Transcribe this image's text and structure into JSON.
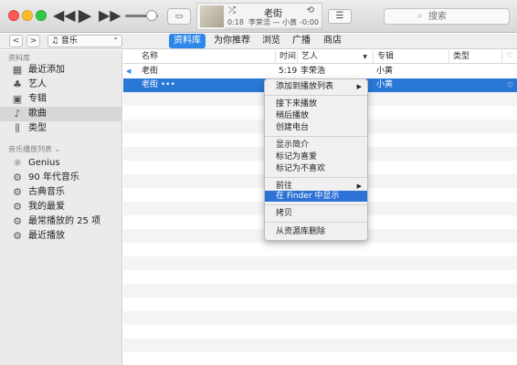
{
  "window": {
    "transport": {
      "prev": "◀◀",
      "play": "▶",
      "next": "▶▶"
    },
    "airplay": "▭",
    "now_playing": {
      "title": "老街",
      "shuffle_icon": "⤮",
      "repeat_icon": "⟲",
      "elapsed": "0:18",
      "artist_album": "李荣浩 — 小黄",
      "remaining": "-0:00",
      "progress": 0.05
    },
    "list_button": "☰",
    "search": {
      "placeholder": "搜索",
      "icon": "⌕"
    }
  },
  "toolbar": {
    "back": "<",
    "forward": ">",
    "media_selector": "♫ 音乐",
    "media_arrow": "⌃",
    "tabs": [
      {
        "label": "资料库",
        "active": true
      },
      {
        "label": "为你推荐"
      },
      {
        "label": "浏览"
      },
      {
        "label": "广播"
      },
      {
        "label": "商店"
      }
    ]
  },
  "sidebar": {
    "library_title": "资料库",
    "library_items": [
      {
        "label": "最近添加",
        "icon": "▦"
      },
      {
        "label": "艺人",
        "icon": "♣"
      },
      {
        "label": "专辑",
        "icon": "▣"
      },
      {
        "label": "歌曲",
        "icon": "♪",
        "selected": true
      },
      {
        "label": "类型",
        "icon": "⫼"
      }
    ],
    "playlists_title": "音乐播放列表 ⌄",
    "playlist_items": [
      {
        "label": "Genius",
        "icon": "⚛"
      },
      {
        "label": "90 年代音乐",
        "icon": "⚙"
      },
      {
        "label": "古典音乐",
        "icon": "⚙"
      },
      {
        "label": "我的最爱",
        "icon": "⚙"
      },
      {
        "label": "最常播放的 25 项",
        "icon": "⚙"
      },
      {
        "label": "最近播放",
        "icon": "⚙"
      }
    ]
  },
  "table": {
    "headers": {
      "name": "名称",
      "time": "时间",
      "artist": "艺人",
      "album": "专辑",
      "genre": "类型",
      "love": "♡"
    },
    "sort_arrow": "▼",
    "rows": [
      {
        "playing_icon": "◀",
        "name": "老街",
        "time": "5:19",
        "artist": "李荣浩",
        "album": "小黄"
      },
      {
        "name": "老街 •••",
        "album": "小黄",
        "love": "♡"
      }
    ]
  },
  "context_menu": {
    "items": [
      {
        "label": "添加到播放列表",
        "submenu": "▶"
      },
      {
        "label": "接下来播放"
      },
      {
        "label": "稍后播放"
      },
      {
        "label": "创建电台"
      },
      {
        "label": "显示简介"
      },
      {
        "label": "标记为喜爱"
      },
      {
        "label": "标记为不喜欢"
      },
      {
        "label": "前往",
        "submenu": "▶"
      },
      {
        "label": "在 Finder 中显示",
        "highlighted": true
      },
      {
        "label": "拷贝"
      },
      {
        "label": "从资源库删除"
      }
    ]
  }
}
